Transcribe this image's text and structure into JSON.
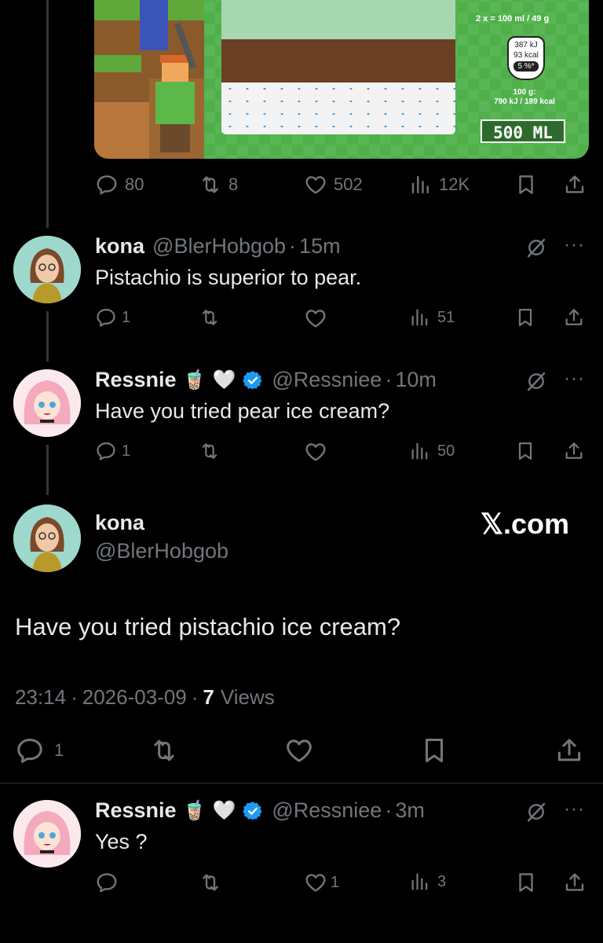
{
  "media": {
    "label_serving": "2 x",
    "label_serving_amount": "= 100 ml / 49 g",
    "label_kj": "387 kJ",
    "label_kcal": "93 kcal",
    "label_percent": "5 %*",
    "label_per100_title": "100 g:",
    "label_per100_values": "790 kJ / 189 kcal",
    "label_volume": "500 ML"
  },
  "top_post_actions": {
    "replies": "80",
    "reposts": "8",
    "likes": "502",
    "views": "12K"
  },
  "reply1": {
    "display_name": "kona",
    "handle": "@BlerHobgob",
    "sep": "·",
    "time": "15m",
    "text": "Pistachio is superior to pear.",
    "replies": "1",
    "views": "51"
  },
  "reply2": {
    "display_name": "Ressnie",
    "emoji_tea": "🧋",
    "emoji_heart": "🤍",
    "handle": "@Ressniee",
    "sep": "·",
    "time": "10m",
    "text": "Have you tried pear ice cream?",
    "replies": "1",
    "views": "50"
  },
  "main_post": {
    "display_name": "kona",
    "handle": "@BlerHobgob",
    "watermark": "𝕏.com",
    "text": "Have you tried pistachio ice cream?",
    "time": "23:14",
    "sep1": "·",
    "date": "2026-03-09",
    "sep2": "·",
    "views_count": "7",
    "views_label": "Views",
    "replies": "1"
  },
  "reply3": {
    "display_name": "Ressnie",
    "emoji_tea": "🧋",
    "emoji_heart": "🤍",
    "handle": "@Ressniee",
    "sep": "·",
    "time": "3m",
    "text": "Yes ?",
    "likes": "1",
    "views": "3"
  },
  "colors": {
    "background": "#000000",
    "text": "#e7e9ea",
    "muted": "#71767b",
    "verified": "#1d9bf0",
    "divider": "#2f3336"
  },
  "icons": [
    "reply-icon",
    "repost-icon",
    "like-icon",
    "views-icon",
    "bookmark-icon",
    "share-icon",
    "grok-icon",
    "more-icon",
    "verified-icon"
  ]
}
